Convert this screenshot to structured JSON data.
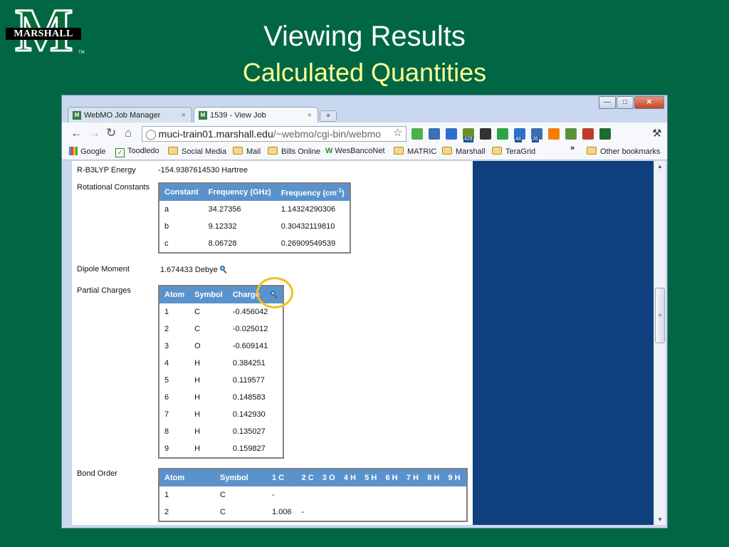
{
  "slide": {
    "logo_text": "MARSHALL",
    "logo_letter": "M",
    "logo_tm": "TM",
    "title": "Viewing Results",
    "subtitle": "Calculated Quantities"
  },
  "browser": {
    "tabs": [
      {
        "label": "WebMO Job Manager",
        "active": false
      },
      {
        "label": "1539 - View Job",
        "active": true
      }
    ],
    "new_tab_label": "+",
    "url_host": "muci-train01.marshall.edu",
    "url_path": "/~webmo/cgi-bin/webmo",
    "extensions": [
      {
        "name": "check-extension-icon",
        "color": "#4caf50",
        "badge": ""
      },
      {
        "name": "translate-extension-icon",
        "color": "#3b6fb6",
        "badge": ""
      },
      {
        "name": "x-extension-icon",
        "color": "#2d6fd0",
        "badge": ""
      },
      {
        "name": "mail-extension-icon",
        "color": "#6a8f2b",
        "badge": "429"
      },
      {
        "name": "rss-extension-icon",
        "color": "#333333",
        "badge": ""
      },
      {
        "name": "sync-extension-icon",
        "color": "#2fa34a",
        "badge": ""
      },
      {
        "name": "chat-extension-icon",
        "color": "#2a71c9",
        "badge": "48"
      },
      {
        "name": "calendar-extension-icon",
        "color": "#3a6fb0",
        "badge": "26"
      },
      {
        "name": "blogger-extension-icon",
        "color": "#f57d00",
        "badge": ""
      },
      {
        "name": "evernote-extension-icon",
        "color": "#5b8f3a",
        "badge": ""
      },
      {
        "name": "adobe-extension-icon",
        "color": "#c0392b",
        "badge": ""
      },
      {
        "name": "plus-extension-icon",
        "color": "#1d6b2d",
        "badge": ""
      }
    ],
    "bookmarks": [
      {
        "label": "Google",
        "icon": "google-icon"
      },
      {
        "label": "Toodledo",
        "icon": "toodledo-icon"
      },
      {
        "label": "Social Media",
        "icon": "folder-icon"
      },
      {
        "label": "Mail",
        "icon": "folder-icon"
      },
      {
        "label": "Bills Online",
        "icon": "folder-icon"
      },
      {
        "label": "WesBancoNet",
        "icon": "wesbanco-icon"
      },
      {
        "label": "MATRIC",
        "icon": "folder-icon"
      },
      {
        "label": "Marshall",
        "icon": "folder-icon"
      },
      {
        "label": "TeraGrid",
        "icon": "folder-icon"
      }
    ],
    "bookmarks_overflow": "»",
    "other_bookmarks": "Other bookmarks"
  },
  "results": {
    "energy": {
      "label": "R-B3LYP Energy",
      "value": "-154.9387614530 Hartree"
    },
    "rotational": {
      "label": "Rotational Constants",
      "headers": [
        "Constant",
        "Frequency (GHz)",
        "Frequency (cm",
        "-1",
        ")"
      ],
      "rows": [
        [
          "a",
          "34.27356",
          "1.14324290306"
        ],
        [
          "b",
          "9.12332",
          "0.30432119810"
        ],
        [
          "c",
          "8.06728",
          "0.26909549539"
        ]
      ]
    },
    "dipole": {
      "label": "Dipole Moment",
      "value": "1.674433 Debye"
    },
    "charges": {
      "label": "Partial Charges",
      "headers": [
        "Atom",
        "Symbol",
        "Charge"
      ],
      "rows": [
        [
          "1",
          "C",
          "-0.456042"
        ],
        [
          "2",
          "C",
          "-0.025012"
        ],
        [
          "3",
          "O",
          "-0.609141"
        ],
        [
          "4",
          "H",
          "0.384251"
        ],
        [
          "5",
          "H",
          "0.119577"
        ],
        [
          "6",
          "H",
          "0.148583"
        ],
        [
          "7",
          "H",
          "0.142930"
        ],
        [
          "8",
          "H",
          "0.135027"
        ],
        [
          "9",
          "H",
          "0.159827"
        ]
      ]
    },
    "bond_order": {
      "label": "Bond Order",
      "headers": [
        "Atom",
        "Symbol",
        "1 C",
        "2 C",
        "3 O",
        "4 H",
        "5 H",
        "6 H",
        "7 H",
        "8 H",
        "9 H"
      ],
      "rows": [
        [
          "1",
          "C",
          "-",
          "",
          "",
          "",
          "",
          "",
          "",
          "",
          ""
        ],
        [
          "2",
          "C",
          "1.006",
          "-",
          "",
          "",
          "",
          "",
          "",
          "",
          ""
        ]
      ]
    }
  }
}
